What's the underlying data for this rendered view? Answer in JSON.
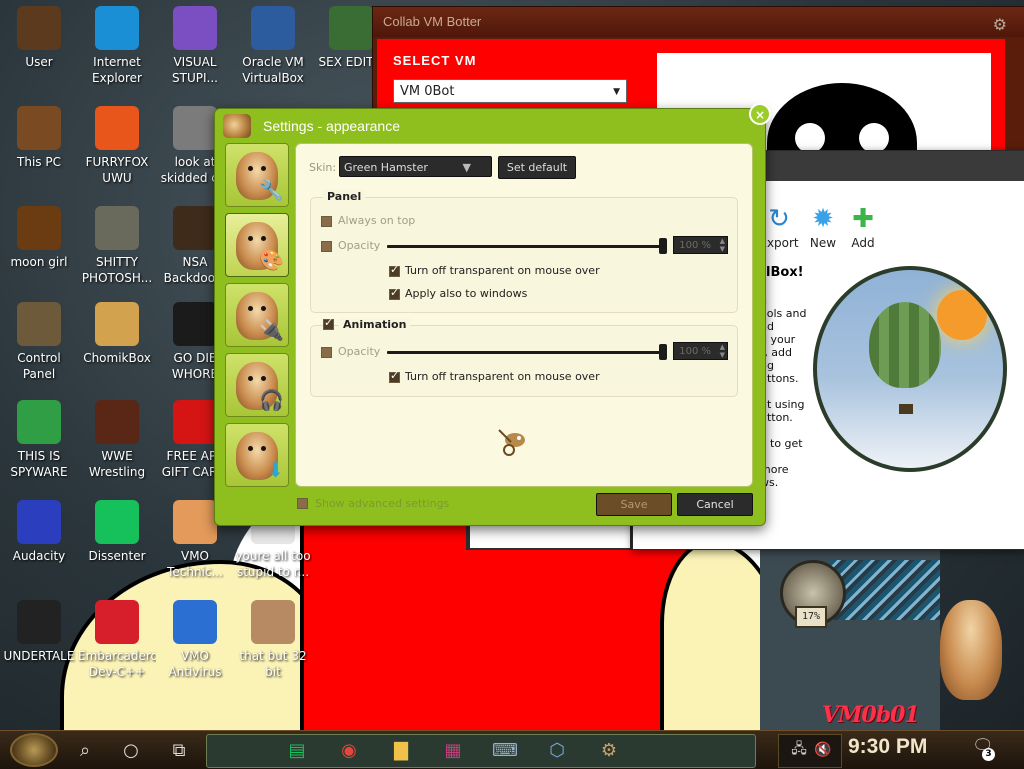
{
  "desktop": {
    "icons": [
      {
        "label": "User",
        "icon": "steampunk-user-icon",
        "color": "#5b3a1d"
      },
      {
        "label": "Internet Explorer",
        "icon": "edge-browser-icon",
        "color": "#1a8fd6"
      },
      {
        "label": "VISUAL STUPI...",
        "icon": "visual-studio-icon",
        "color": "#7b4fc2"
      },
      {
        "label": "Oracle VM VirtualBox",
        "icon": "virtualbox-icon",
        "color": "#2c5b9e"
      },
      {
        "label": "SEX EDIT...",
        "icon": "hex-editor-icon",
        "color": "#3a6d34"
      },
      {
        "label": "This PC",
        "icon": "steampunk-pc-icon",
        "color": "#7a4b22"
      },
      {
        "label": "FURRYFOX UWU",
        "icon": "firefox-icon",
        "color": "#e8561c"
      },
      {
        "label": "look at skidded c...",
        "icon": "copy-files-icon",
        "color": "#7b7b7b"
      },
      {
        "label": "moon girl",
        "icon": "barrel-icon",
        "color": "#6b3c12"
      },
      {
        "label": "SHITTY PHOTOSH...",
        "icon": "gimp-icon",
        "color": "#6a6a5c"
      },
      {
        "label": "NSA Backdoo...",
        "icon": "steampunk-box-icon",
        "color": "#3e2b1a"
      },
      {
        "label": "Control Panel",
        "icon": "lightbulb-icon",
        "color": "#6d5a3a"
      },
      {
        "label": "ChomikBox",
        "icon": "chomikbox-icon",
        "color": "#d2a24e"
      },
      {
        "label": "GO DIE WHORE",
        "icon": "dev-folder-icon",
        "color": "#1b1b1b"
      },
      {
        "label": "THIS IS SPYWARE",
        "icon": "chrome-icon",
        "color": "#2f9e44"
      },
      {
        "label": "WWE Wrestling",
        "icon": "oven-icon",
        "color": "#5a2616"
      },
      {
        "label": "FREE APP GIFT CAR...",
        "icon": "apple-icon",
        "color": "#d51414"
      },
      {
        "label": "Audacity",
        "icon": "audacity-icon",
        "color": "#2b3fbe"
      },
      {
        "label": "Dissenter",
        "icon": "dissenter-icon",
        "color": "#16c05a"
      },
      {
        "label": "VMO Technic...",
        "icon": "technician-icon",
        "color": "#e39a5a"
      },
      {
        "label": "youre all too stupid to r...",
        "icon": "text-file-icon",
        "color": "#e7e7e7"
      },
      {
        "label": "UNDERTALE",
        "icon": "unity-icon",
        "color": "#222222"
      },
      {
        "label": "Embarcadero Dev-C++",
        "icon": "devcpp-icon",
        "color": "#d61f2b"
      },
      {
        "label": "VMO Antivirus",
        "icon": "shield-icon",
        "color": "#2a6fd1"
      },
      {
        "label": "that but 32 bit",
        "icon": "portrait-icon",
        "color": "#b78a63"
      }
    ],
    "signature": "VM0b01",
    "gauge_readout": "17%"
  },
  "collab": {
    "title": "Collab VM Botter",
    "select_label": "SELECT VM",
    "vm_value": "VM 0Bot"
  },
  "vbox": {
    "tools": [
      {
        "label": "Export",
        "icon": "export-icon"
      },
      {
        "label": "New",
        "icon": "new-icon"
      },
      {
        "label": "Add",
        "icon": "add-icon"
      }
    ],
    "heading": "lBox!",
    "body_lines": [
      "n",
      "ools and",
      "nd",
      "n your",
      "t, add",
      "ng",
      "uttons.",
      "",
      "nt using",
      "utton.",
      "",
      "y to get",
      "",
      "more",
      "ws."
    ]
  },
  "settings": {
    "title": "Settings - appearance",
    "skin_label": "Skin:",
    "skin_value": "Green Hamster",
    "set_default": "Set default",
    "panel": {
      "title": "Panel",
      "always_on_top": "Always on top",
      "opacity": "Opacity",
      "opacity_value": "100 %",
      "opacity_level": 1.0,
      "transparent_mouse": "Turn off transparent on mouse over",
      "apply_windows": "Apply also to windows"
    },
    "animation": {
      "title": "Animation",
      "opacity": "Opacity",
      "opacity_value": "100 %",
      "opacity_level": 1.0,
      "transparent_mouse": "Turn off transparent on mouse over"
    },
    "advanced": "Show advanced settings",
    "save": "Save",
    "cancel": "Cancel",
    "close": "×"
  },
  "taskbar": {
    "time": "9:30 PM",
    "notifications": "3",
    "pinned": [
      "dissenter-icon",
      "chrome-icon",
      "folder-icon",
      "winrar-icon",
      "keyboard-icon",
      "virtualbox-icon",
      "chomikbox-gear-icon"
    ]
  },
  "colors": {
    "settings_green": "#8fbf1e",
    "panel_cream": "#fbf9df",
    "collab_red": "#ff0000",
    "taskbar_brown": "#2b1e12"
  }
}
